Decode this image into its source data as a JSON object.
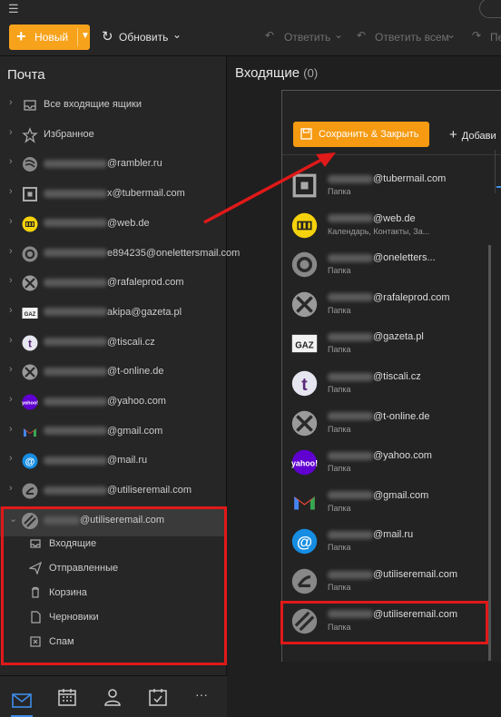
{
  "toolbar": {
    "menu_icon": "hamburger-icon",
    "new_label": "Новый",
    "refresh_label": "Обновить",
    "reply_label": "Ответить",
    "reply_all_label": "Ответить всем",
    "forward_label": "Пе"
  },
  "sidebar": {
    "title": "Почта",
    "accounts": [
      {
        "icon": "inbox-stack-icon",
        "label": "Все входящие ящики",
        "blur": false
      },
      {
        "icon": "star-icon",
        "label": "Избранное",
        "blur": false
      },
      {
        "icon": "rambler-icon",
        "label": "@rambler.ru",
        "blur": true
      },
      {
        "icon": "tubermail-icon",
        "label": "x@tubermail.com",
        "blur": true
      },
      {
        "icon": "webde-icon",
        "label": "@web.de",
        "blur": true
      },
      {
        "icon": "oneletters-icon",
        "label": "e894235@onelettersmail.com",
        "blur": true
      },
      {
        "icon": "rafaleprod-icon",
        "label": "@rafaleprod.com",
        "blur": true
      },
      {
        "icon": "gazeta-icon",
        "label": "akipa@gazeta.pl",
        "blur": true
      },
      {
        "icon": "tiscali-icon",
        "label": "@tiscali.cz",
        "blur": true
      },
      {
        "icon": "t-online-icon",
        "label": "@t-online.de",
        "blur": true
      },
      {
        "icon": "yahoo-icon",
        "label": "@yahoo.com",
        "blur": true
      },
      {
        "icon": "gmail-icon",
        "label": "@gmail.com",
        "blur": true
      },
      {
        "icon": "mailru-icon",
        "label": "@mail.ru",
        "blur": true
      },
      {
        "icon": "utilise-icon",
        "label": "@utiliseremail.com",
        "blur": true
      }
    ],
    "expanded_account": {
      "icon": "utilise-stripe-icon",
      "label": "@utiliseremail.com"
    },
    "folders": [
      {
        "icon": "inbox-icon",
        "label": "Входящие"
      },
      {
        "icon": "send-icon",
        "label": "Отправленные"
      },
      {
        "icon": "trash-icon",
        "label": "Корзина"
      },
      {
        "icon": "draft-icon",
        "label": "Черновики"
      },
      {
        "icon": "spam-icon",
        "label": "Спам"
      }
    ]
  },
  "bottom_nav": [
    "mail-icon",
    "calendar-icon",
    "contacts-icon",
    "tasks-icon",
    "more-icon"
  ],
  "bottom_more": "···",
  "main": {
    "title": "Входящие",
    "count": "(0)"
  },
  "panel": {
    "save_close_label": "Сохранить & Закрыть",
    "add_label": "Добави",
    "items": [
      {
        "icon": "tubermail-icon",
        "email": "@tubermail.com",
        "sub": "Папка"
      },
      {
        "icon": "webde-icon",
        "email": "@web.de",
        "sub": "Календарь, Контакты, За..."
      },
      {
        "icon": "oneletters-icon",
        "email": "@oneletters...",
        "sub": "Папка"
      },
      {
        "icon": "rafaleprod-icon",
        "email": "@rafaleprod.com",
        "sub": "Папка"
      },
      {
        "icon": "gazeta-icon",
        "email": "@gazeta.pl",
        "sub": "Папка"
      },
      {
        "icon": "tiscali-icon",
        "email": "@tiscali.cz",
        "sub": "Папка"
      },
      {
        "icon": "t-online-icon",
        "email": "@t-online.de",
        "sub": "Папка"
      },
      {
        "icon": "yahoo-icon",
        "email": "@yahoo.com",
        "sub": "Папка"
      },
      {
        "icon": "gmail-icon",
        "email": "@gmail.com",
        "sub": "Папка"
      },
      {
        "icon": "mailru-icon",
        "email": "@mail.ru",
        "sub": "Папка"
      },
      {
        "icon": "utilise-icon",
        "email": "@utiliseremail.com",
        "sub": "Папка"
      },
      {
        "icon": "utilise-stripe-icon",
        "email": "@utiliseremail.com",
        "sub": "Папка"
      }
    ]
  },
  "colors": {
    "accent": "#f7a21b",
    "highlight": "#e01919",
    "blue": "#3f8de8"
  }
}
